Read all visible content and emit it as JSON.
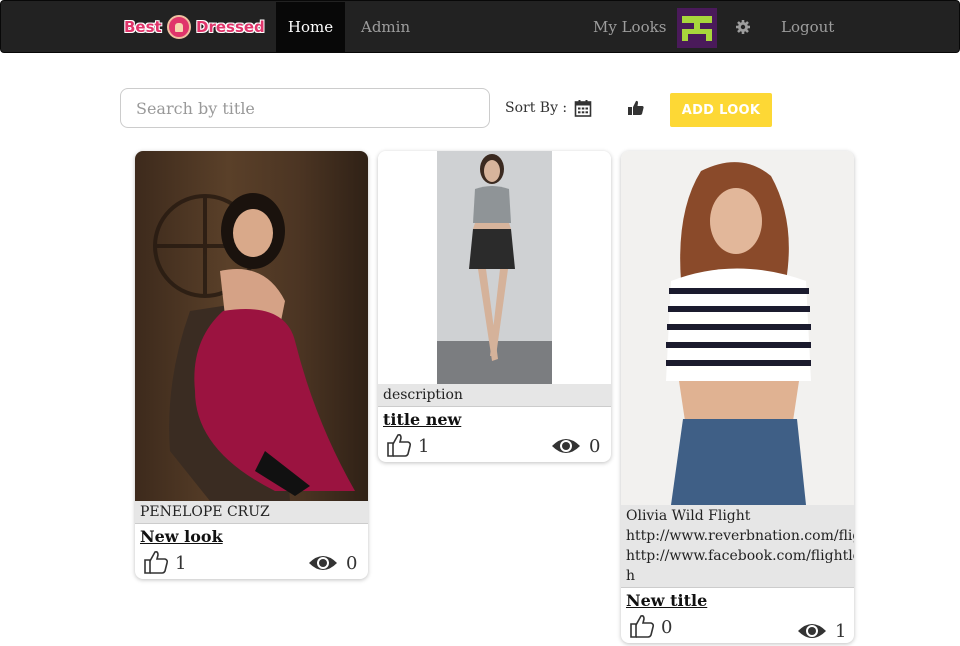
{
  "nav": {
    "brand_word1": "Best",
    "brand_word2": "Dressed",
    "home": "Home",
    "admin": "Admin",
    "my_looks": "My Looks",
    "logout": "Logout"
  },
  "toolbar": {
    "search_placeholder": "Search by title",
    "sort_by_label": "Sort By :",
    "sort_date_icon": "calendar-icon",
    "sort_likes_icon": "thumbs-up-icon",
    "add_look_label": "ADD LOOK"
  },
  "colors": {
    "navbar_bg": "#222222",
    "add_look_bg": "#fdd835",
    "brand_pink": "#e0356b",
    "avatar_bg": "#4a1a5a",
    "avatar_fg": "#a8d63c"
  },
  "cards": [
    {
      "description": "PENELOPE CRUZ",
      "title": "New look",
      "likes": "1",
      "views": "0"
    },
    {
      "description": "description",
      "title": "title new",
      "likes": "1",
      "views": "0"
    },
    {
      "description_lines": [
        "Olivia Wild Flight",
        "http://www.reverbnation.com/fligh",
        "http://www.facebook.com/flightlos",
        "h"
      ],
      "title": "New title",
      "likes": "0",
      "views": "1"
    }
  ]
}
